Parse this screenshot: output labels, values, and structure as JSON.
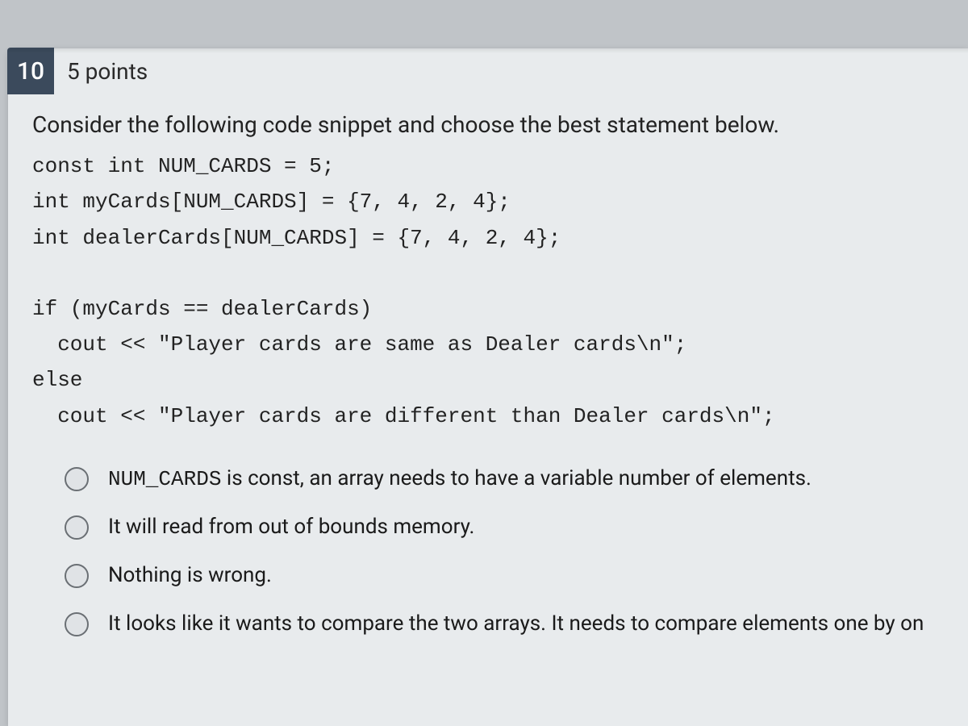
{
  "question": {
    "number": "10",
    "points_label": "5 points",
    "prompt": "Consider the following code snippet and choose the best statement below.",
    "code_lines": [
      "const int NUM_CARDS = 5;",
      "int myCards[NUM_CARDS] = {7, 4, 2, 4};",
      "int dealerCards[NUM_CARDS] = {7, 4, 2, 4};",
      "",
      "if (myCards == dealerCards)",
      "  cout << \"Player cards are same as Dealer cards\\n\";",
      "else",
      "  cout << \"Player cards are different than Dealer cards\\n\";"
    ],
    "options": [
      {
        "prefix_code": "NUM_CARDS",
        "text": " is const, an array needs to have a variable number of elements."
      },
      {
        "prefix_code": "",
        "text": "It will read from out of bounds memory."
      },
      {
        "prefix_code": "",
        "text": "Nothing is wrong."
      },
      {
        "prefix_code": "",
        "text": "It looks like it wants to compare the two arrays.  It needs to compare elements one by on"
      }
    ]
  }
}
